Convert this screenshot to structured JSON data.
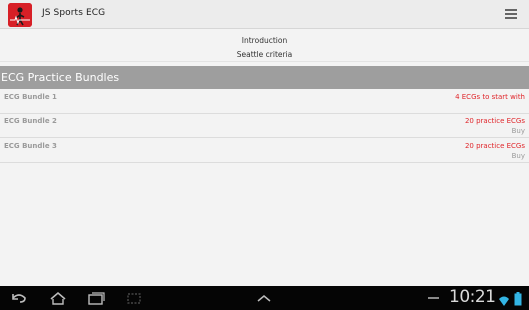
{
  "app": {
    "title": "JS Sports ECG",
    "icon": "heart-ecg-icon",
    "brand_color": "#d71f26"
  },
  "menu": {
    "items": [
      {
        "label": "Introduction"
      },
      {
        "label": "Seattle criteria"
      }
    ]
  },
  "section": {
    "title": "ECG Practice Bundles"
  },
  "bundles": [
    {
      "name": "ECG Bundle 1",
      "description": "4 ECGs to start with",
      "action": ""
    },
    {
      "name": "ECG Bundle 2",
      "description": "20 practice ECGs",
      "action": "Buy"
    },
    {
      "name": "ECG Bundle 3",
      "description": "20 practice ECGs",
      "action": "Buy"
    }
  ],
  "system_bar": {
    "time": "10:21",
    "icons": [
      "back-icon",
      "home-icon",
      "recent-apps-icon",
      "screenshot-icon",
      "up-chevron-icon",
      "wifi-icon",
      "battery-icon"
    ]
  },
  "colors": {
    "accent_red": "#e0262b",
    "header_gray": "#9e9e9e"
  }
}
